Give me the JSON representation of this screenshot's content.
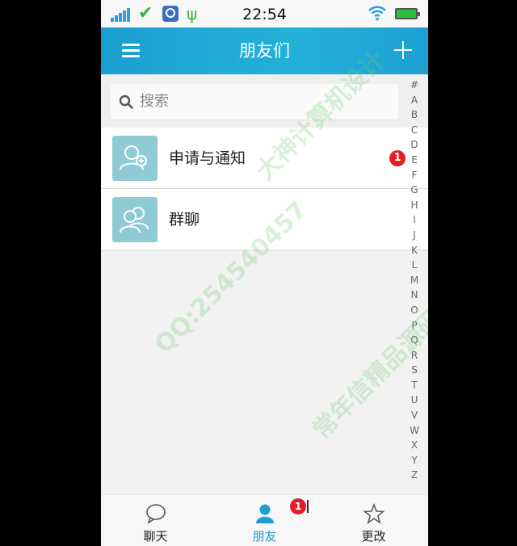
{
  "status_bar": {
    "time": "22:54",
    "icons": [
      "signal-icon",
      "check-icon",
      "app-notification-icon",
      "usb-icon",
      "wifi-icon",
      "battery-icon"
    ]
  },
  "nav": {
    "title": "朋友们",
    "menu_icon": "menu-icon",
    "add_icon": "plus-icon"
  },
  "search": {
    "placeholder": "搜索"
  },
  "list": {
    "items": [
      {
        "label": "申请与通知",
        "icon": "add-contact-icon",
        "badge": "1"
      },
      {
        "label": "群聊",
        "icon": "group-icon"
      }
    ]
  },
  "index_bar": {
    "letters": [
      "#",
      "A",
      "B",
      "C",
      "D",
      "E",
      "F",
      "G",
      "H",
      "I",
      "J",
      "K",
      "L",
      "M",
      "N",
      "O",
      "P",
      "Q",
      "R",
      "S",
      "T",
      "U",
      "V",
      "W",
      "X",
      "Y",
      "Z"
    ]
  },
  "tabs": {
    "items": [
      {
        "label": "聊天",
        "icon": "chat-bubble-icon"
      },
      {
        "label": "朋友",
        "icon": "person-icon",
        "active": true
      },
      {
        "label": "更改",
        "icon": "star-icon"
      }
    ],
    "badge": "1"
  },
  "watermark": {
    "texts": [
      "QQ:254540457",
      "大神计算机设计",
      "常年信精品源码"
    ]
  },
  "colors": {
    "nav_bar": "#1ea8d6",
    "accent": "#1e9fd2",
    "badge": "#e21f26",
    "avatar_bg": "#8fcbd4"
  }
}
